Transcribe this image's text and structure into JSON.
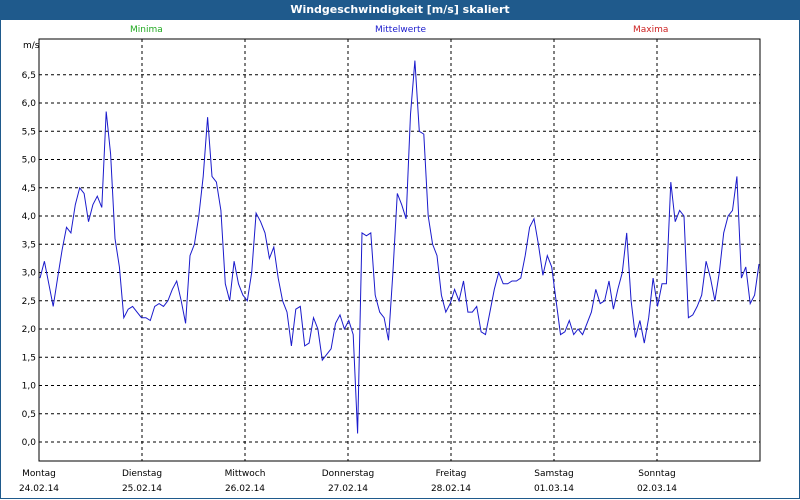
{
  "window": {
    "title": "Windgeschwindigkeit [m/s] skaliert"
  },
  "legend": [
    {
      "label": "Minima",
      "color": "#22aa22"
    },
    {
      "label": "Mittelwerte",
      "color": "#1a1acc"
    },
    {
      "label": "Maxima",
      "color": "#cc2222"
    }
  ],
  "chart_data": {
    "type": "line",
    "title": "Windgeschwindigkeit [m/s] skaliert",
    "ylabel": "m/s",
    "ylim": [
      -0.3,
      7.0
    ],
    "yticks": [
      "0,0",
      "0,5",
      "1,0",
      "1,5",
      "2,0",
      "2,5",
      "3,0",
      "3,5",
      "4,0",
      "4,5",
      "5,0",
      "5,5",
      "6,0",
      "6,5"
    ],
    "grid": true,
    "days": [
      {
        "name": "Montag",
        "date": "24.02.14"
      },
      {
        "name": "Dienstag",
        "date": "25.02.14"
      },
      {
        "name": "Mittwoch",
        "date": "26.02.14"
      },
      {
        "name": "Donnerstag",
        "date": "27.02.14"
      },
      {
        "name": "Freitag",
        "date": "28.02.14"
      },
      {
        "name": "Samstag",
        "date": "01.03.14"
      },
      {
        "name": "Sonntag",
        "date": "02.03.14"
      }
    ],
    "series": [
      {
        "color": "#1a1acc",
        "sample_interval_h": 1.714,
        "values": [
          2.9,
          3.2,
          2.8,
          2.4,
          2.9,
          3.4,
          3.8,
          3.7,
          4.2,
          4.5,
          4.4,
          3.9,
          4.2,
          4.35,
          4.15,
          5.85,
          5.1,
          3.6,
          3.1,
          2.2,
          2.35,
          2.4,
          2.3,
          2.2,
          2.2,
          2.15,
          2.4,
          2.45,
          2.4,
          2.5,
          2.7,
          2.85,
          2.5,
          2.1,
          3.3,
          3.5,
          4.0,
          4.7,
          5.75,
          4.7,
          4.6,
          4.1,
          2.8,
          2.5,
          3.2,
          2.8,
          2.6,
          2.5,
          3.0,
          4.05,
          3.9,
          3.7,
          3.25,
          3.45,
          2.9,
          2.5,
          2.3,
          1.7,
          2.35,
          2.4,
          1.7,
          1.75,
          2.2,
          2.0,
          1.45,
          1.55,
          1.65,
          2.1,
          2.25,
          2.0,
          2.15,
          1.9,
          0.15,
          3.7,
          3.65,
          3.7,
          2.6,
          2.3,
          2.2,
          1.8,
          3.0,
          4.4,
          4.2,
          3.95,
          5.8,
          6.75,
          5.5,
          5.45,
          4.0,
          3.5,
          3.3,
          2.6,
          2.3,
          2.45,
          2.7,
          2.5,
          2.85,
          2.3,
          2.3,
          2.4,
          1.95,
          1.9,
          2.3,
          2.7,
          3.0,
          2.8,
          2.8,
          2.85,
          2.85,
          2.9,
          3.3,
          3.8,
          3.95,
          3.5,
          2.95,
          3.3,
          3.1,
          2.5,
          1.9,
          1.95,
          2.15,
          1.9,
          2.0,
          1.9,
          2.1,
          2.3,
          2.7,
          2.45,
          2.5,
          2.85,
          2.35,
          2.7,
          3.0,
          3.7,
          2.5,
          1.85,
          2.15,
          1.75,
          2.2,
          2.9,
          2.4,
          2.8,
          2.8,
          4.6,
          3.9,
          4.1,
          4.0,
          2.2,
          2.25,
          2.4,
          2.6,
          3.2,
          2.9,
          2.5,
          3.0,
          3.7,
          4.0,
          4.1,
          4.7,
          2.9,
          3.1,
          2.45,
          2.6,
          3.15
        ]
      }
    ]
  }
}
